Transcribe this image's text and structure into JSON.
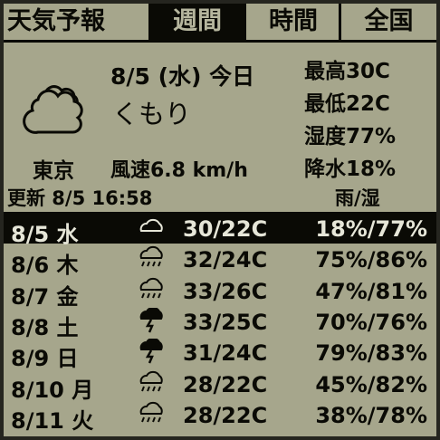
{
  "tabs": {
    "app_title": "天気予報",
    "week": "週間",
    "hour": "時間",
    "nation": "全国"
  },
  "today": {
    "date_label": "8/5 (水) 今日",
    "condition": "くもり",
    "icon": "cloudy-icon",
    "high": "最高30C",
    "low": "最低22C",
    "humidity": "湿度77%",
    "precip": "降水18%",
    "city": "東京",
    "wind": "風速6.8 km/h",
    "updated": "更新 8/5 16:58",
    "list_header": "雨/湿"
  },
  "forecast": [
    {
      "date": "8/5 水",
      "icon": "cloudy-icon",
      "temp": "30/22C",
      "precip": "18%/77%"
    },
    {
      "date": "8/6 木",
      "icon": "rain-cloud-icon",
      "temp": "32/24C",
      "precip": "75%/86%"
    },
    {
      "date": "8/7 金",
      "icon": "rain-cloud-icon",
      "temp": "33/26C",
      "precip": "47%/81%"
    },
    {
      "date": "8/8 土",
      "icon": "thunderstorm-icon",
      "temp": "33/25C",
      "precip": "70%/76%"
    },
    {
      "date": "8/9 日",
      "icon": "thunderstorm-icon",
      "temp": "31/24C",
      "precip": "79%/83%"
    },
    {
      "date": "8/10 月",
      "icon": "rain-cloud-icon",
      "temp": "28/22C",
      "precip": "45%/82%"
    },
    {
      "date": "8/11 火",
      "icon": "rain-cloud-icon",
      "temp": "28/22C",
      "precip": "38%/78%"
    }
  ],
  "colors": {
    "lcd_background": "#a6a68c",
    "lcd_ink": "#0a0a05",
    "bezel": "#25251f"
  }
}
